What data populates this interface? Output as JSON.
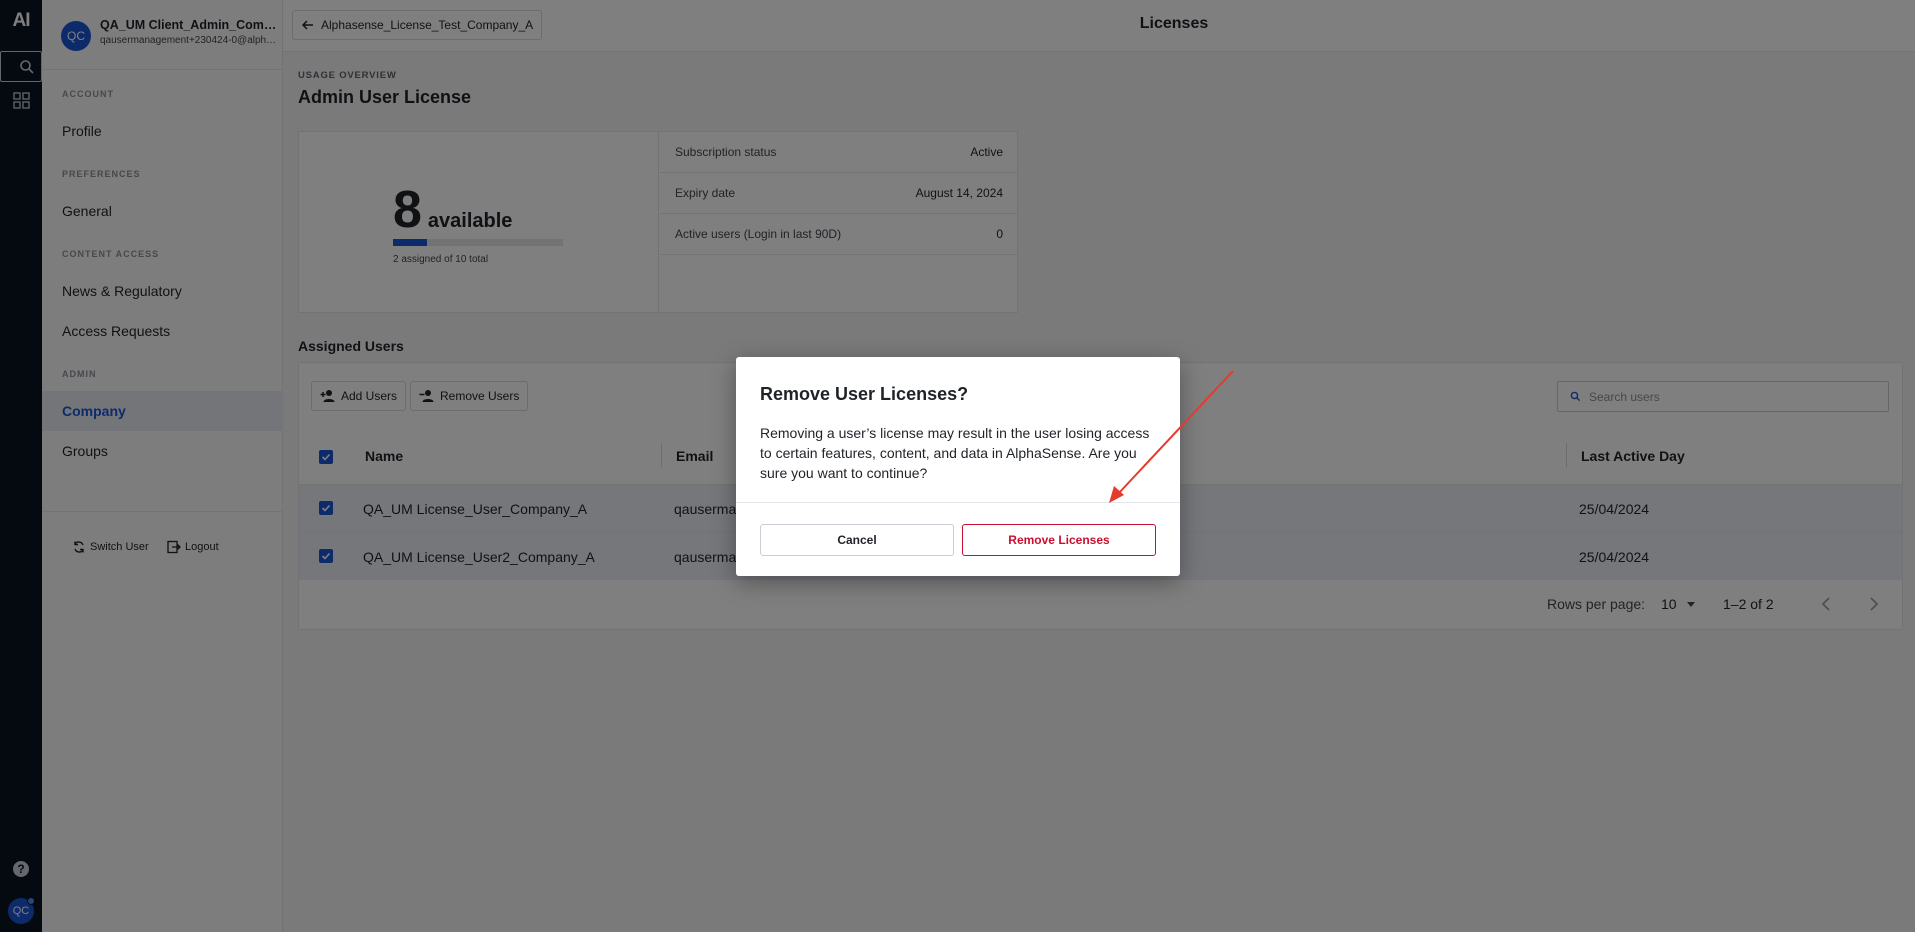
{
  "rail": {
    "logo": "AI",
    "icons": [
      "search-icon",
      "apps-icon",
      "help-icon"
    ],
    "avatar": "QC"
  },
  "sidebar": {
    "account": {
      "initials": "QC",
      "name": "QA_UM Client_Admin_Compan...",
      "email": "qausermanagement+230424-0@alpha-..."
    },
    "sections": {
      "account": "ACCOUNT",
      "preferences": "PREFERENCES",
      "content_access": "CONTENT ACCESS",
      "admin": "ADMIN"
    },
    "items": {
      "profile": "Profile",
      "general": "General",
      "news": "News & Regulatory",
      "access_requests": "Access Requests",
      "company": "Company",
      "groups": "Groups"
    },
    "switch_user": "Switch User",
    "logout": "Logout"
  },
  "header": {
    "back_label": "Alphasense_License_Test_Company_A",
    "title": "Licenses"
  },
  "overview": {
    "overline": "USAGE OVERVIEW",
    "title": "Admin User License",
    "available_count": "8",
    "available_label": "available",
    "assigned_fraction": 0.2,
    "assigned_text": "2 assigned of 10 total",
    "details": [
      {
        "key": "Subscription status",
        "value": "Active"
      },
      {
        "key": "Expiry date",
        "value": "August 14, 2024"
      },
      {
        "key": "Active users (Login in last 90D)",
        "value": "0"
      }
    ]
  },
  "users": {
    "title": "Assigned Users",
    "add_label": "Add Users",
    "remove_label": "Remove Users",
    "search_placeholder": "Search users",
    "columns": {
      "name": "Name",
      "email": "Email",
      "last_active": "Last Active Day"
    },
    "rows": [
      {
        "name": "QA_UM License_User_Company_A",
        "email": "qauserma",
        "last_active": "25/04/2024"
      },
      {
        "name": "QA_UM License_User2_Company_A",
        "email": "qauserma",
        "last_active": "25/04/2024"
      }
    ],
    "rows_per_page_label": "Rows per page:",
    "rows_per_page": "10",
    "range": "1–2 of 2"
  },
  "dialog": {
    "title": "Remove User Licenses?",
    "body": "Removing a user’s license may result in the user losing access to certain features, content, and data in AlphaSense. Are you sure you want to continue?",
    "cancel": "Cancel",
    "confirm": "Remove Licenses"
  },
  "colors": {
    "accent": "#1a55d6",
    "danger": "#c8102e",
    "annotation_arrow": "#e53b2c"
  }
}
